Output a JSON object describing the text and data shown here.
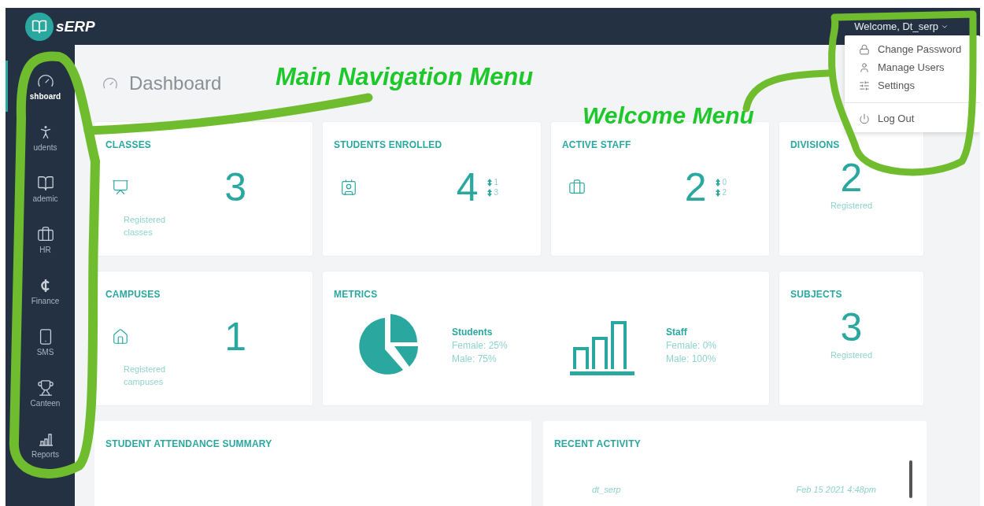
{
  "brand": {
    "name": "sERP"
  },
  "user_menu": {
    "label": "Welcome, Dt_serp",
    "expanded": true,
    "items": [
      {
        "label": "Change Password",
        "divider_before": false
      },
      {
        "label": "Manage Users",
        "divider_before": false
      },
      {
        "label": "Settings",
        "divider_before": false
      },
      {
        "label": "Log Out",
        "divider_before": true
      }
    ]
  },
  "sidebar": {
    "items": [
      {
        "label": "shboard",
        "selected": true
      },
      {
        "label": "udents",
        "selected": false
      },
      {
        "label": "ademic",
        "selected": false
      },
      {
        "label": "HR",
        "selected": false
      },
      {
        "label": "Finance",
        "selected": false
      },
      {
        "label": "SMS",
        "selected": false
      },
      {
        "label": "Canteen",
        "selected": false
      },
      {
        "label": "Reports",
        "selected": false
      }
    ]
  },
  "page_title": "Dashboard",
  "stat_cards": [
    {
      "kind": "icon_stat",
      "title": "CLASSES",
      "value": "3",
      "caption": "Registered classes"
    },
    {
      "kind": "icon_stat",
      "title": "STUDENTS ENROLLED",
      "value": "4",
      "breakdown": [
        "1",
        "3"
      ]
    },
    {
      "kind": "icon_stat",
      "title": "ACTIVE STAFF",
      "value": "2",
      "breakdown": [
        "0",
        "2"
      ]
    },
    {
      "kind": "centered_stat",
      "title": "DIVISIONS",
      "value": "2",
      "caption": "Registered"
    },
    {
      "kind": "icon_stat",
      "title": "CAMPUSES",
      "value": "1",
      "caption": "Registered campuses"
    },
    {
      "kind": "metrics",
      "title": "METRICS",
      "groups": [
        {
          "name": "Students",
          "lines": [
            "Female: 25%",
            "Male: 75%"
          ]
        },
        {
          "name": "Staff",
          "lines": [
            "Female: 0%",
            "Male: 100%"
          ]
        }
      ]
    },
    {
      "kind": "centered_stat",
      "title": "SUBJECTS",
      "value": "3",
      "caption": "Registered"
    }
  ],
  "attendance": {
    "title": "STUDENT ATTENDANCE SUMMARY"
  },
  "recent_activity": {
    "title": "RECENT ACTIVITY",
    "rows": [
      {
        "user": "dt_serp",
        "time": "Feb 15 2021 4:48pm"
      }
    ]
  },
  "annotations": [
    {
      "text": "Main Navigation Menu"
    },
    {
      "text": "Welcome Menu"
    }
  ]
}
